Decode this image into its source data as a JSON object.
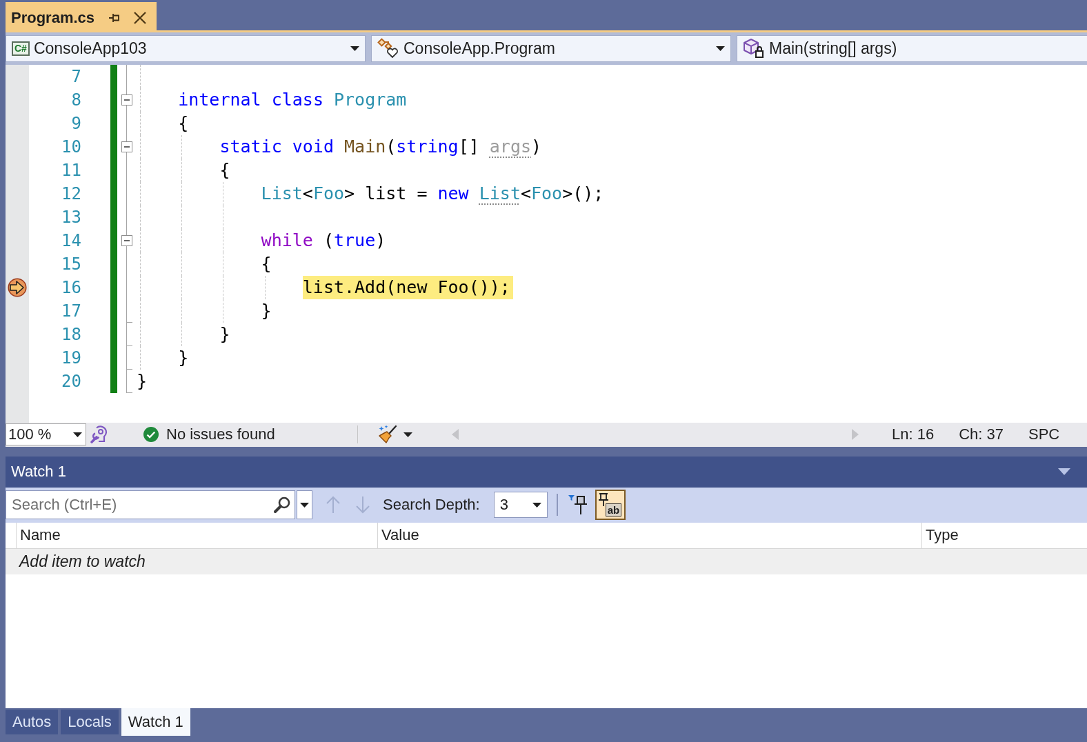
{
  "document_tab": {
    "title": "Program.cs",
    "selected": true
  },
  "navigation_bar": {
    "project": {
      "language": "C#",
      "name": "ConsoleApp103"
    },
    "type": {
      "name": "ConsoleApp.Program"
    },
    "member": {
      "name": "Main(string[] args)"
    }
  },
  "editor": {
    "lines": [
      {
        "number": "7",
        "changed": true,
        "current": false
      },
      {
        "number": "8",
        "changed": true,
        "current": false,
        "outline": {
          "kind": "toggle",
          "expanded": true
        },
        "tokens": [
          {
            "kind": "keyword",
            "text": "    internal "
          },
          {
            "kind": "keyword",
            "text": "class "
          },
          {
            "kind": "type",
            "text": "Program"
          }
        ]
      },
      {
        "number": "9",
        "changed": true,
        "current": false,
        "tokens": [
          {
            "kind": "plain",
            "text": "    {"
          }
        ]
      },
      {
        "number": "10",
        "changed": true,
        "current": false,
        "outline": {
          "kind": "toggle",
          "expanded": true
        },
        "tokens": [
          {
            "kind": "keyword",
            "text": "        static "
          },
          {
            "kind": "keyword",
            "text": "void "
          },
          {
            "kind": "method",
            "text": "Main"
          },
          {
            "kind": "plain",
            "text": "("
          },
          {
            "kind": "keyword",
            "text": "string"
          },
          {
            "kind": "plain",
            "text": "[] "
          },
          {
            "kind": "unused",
            "text": "args",
            "hint": true
          },
          {
            "kind": "plain",
            "text": ")"
          }
        ]
      },
      {
        "number": "11",
        "changed": true,
        "current": false,
        "tokens": [
          {
            "kind": "plain",
            "text": "        {"
          }
        ]
      },
      {
        "number": "12",
        "changed": true,
        "current": false,
        "tokens": [
          {
            "kind": "type",
            "text": "            List"
          },
          {
            "kind": "plain",
            "text": "<"
          },
          {
            "kind": "type",
            "text": "Foo"
          },
          {
            "kind": "plain",
            "text": "> list = "
          },
          {
            "kind": "keyword",
            "text": "new "
          },
          {
            "kind": "type",
            "text": "List",
            "hint": true
          },
          {
            "kind": "plain",
            "text": "<"
          },
          {
            "kind": "type",
            "text": "Foo"
          },
          {
            "kind": "plain",
            "text": ">();"
          }
        ]
      },
      {
        "number": "13",
        "changed": true,
        "current": false
      },
      {
        "number": "14",
        "changed": true,
        "current": false,
        "outline": {
          "kind": "toggle",
          "expanded": true
        },
        "tokens": [
          {
            "kind": "control",
            "text": "            while"
          },
          {
            "kind": "plain",
            "text": " ("
          },
          {
            "kind": "keyword",
            "text": "true"
          },
          {
            "kind": "plain",
            "text": ")"
          }
        ]
      },
      {
        "number": "15",
        "changed": true,
        "current": false,
        "tokens": [
          {
            "kind": "plain",
            "text": "            {"
          }
        ]
      },
      {
        "number": "16",
        "changed": true,
        "current": true,
        "tokens": [
          {
            "kind": "plain",
            "text": "                list.Add(new Foo());"
          }
        ]
      },
      {
        "number": "17",
        "changed": true,
        "current": false,
        "outline": {
          "kind": "end"
        },
        "tokens": [
          {
            "kind": "plain",
            "text": "            }"
          }
        ]
      },
      {
        "number": "18",
        "changed": true,
        "current": false,
        "outline": {
          "kind": "end"
        },
        "tokens": [
          {
            "kind": "plain",
            "text": "        }"
          }
        ]
      },
      {
        "number": "19",
        "changed": true,
        "current": false,
        "outline": {
          "kind": "end"
        },
        "tokens": [
          {
            "kind": "plain",
            "text": "    }"
          }
        ]
      },
      {
        "number": "20",
        "changed": true,
        "current": false,
        "outline": {
          "kind": "end"
        },
        "tokens": [
          {
            "kind": "plain",
            "text": "}"
          }
        ]
      }
    ]
  },
  "status_bar": {
    "zoom": "100 %",
    "issues": "No issues found",
    "line": "Ln: 16",
    "column": "Ch: 37",
    "indentation": "SPC"
  },
  "watch_window": {
    "title": "Watch 1",
    "search": {
      "placeholder": "Search (Ctrl+E)"
    },
    "history_buttons": [
      {
        "kind": "up",
        "disabled": true
      },
      {
        "kind": "down",
        "disabled": true
      }
    ],
    "search_depth": {
      "label": "Search Depth:",
      "value": "3"
    },
    "toggles": [
      {
        "kind": "pin-filter",
        "selected": false
      },
      {
        "kind": "pin-text",
        "label": "ab",
        "selected": true
      }
    ],
    "columns": [
      "Name",
      "Value",
      "Type"
    ],
    "add_item": "Add item to watch"
  },
  "panel_tabs": [
    {
      "label": "Autos",
      "selected": false
    },
    {
      "label": "Locals",
      "selected": false
    },
    {
      "label": "Watch 1",
      "selected": true
    }
  ]
}
